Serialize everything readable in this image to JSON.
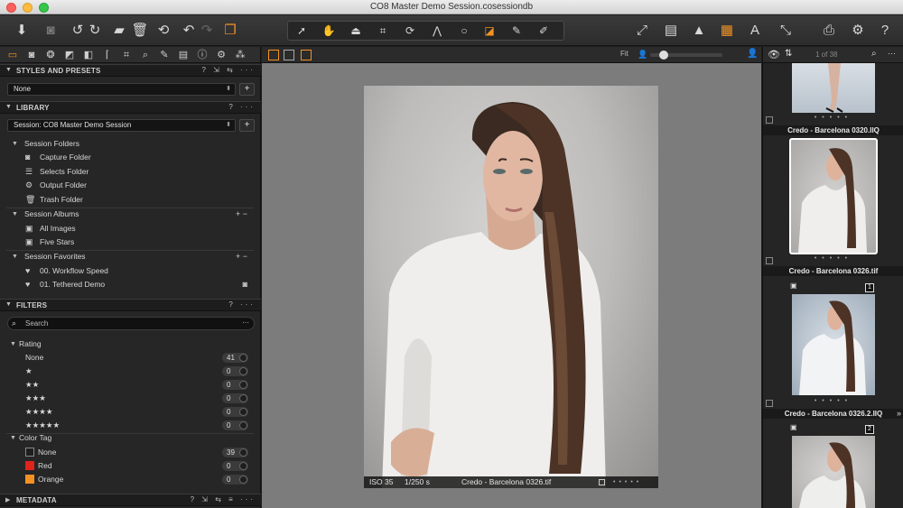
{
  "window": {
    "title": "CO8 Master Demo Session.cosessiondb"
  },
  "toolbar": {
    "left_icons": [
      "import-icon",
      "camera-icon",
      "rotate-left-icon",
      "rotate-right-icon",
      "folder-move-icon",
      "trash-icon",
      "undo-last-icon",
      "undo-icon",
      "redo-icon",
      "stack-icon"
    ],
    "cursor_tools": [
      "select-icon",
      "pan-icon",
      "loupe-icon",
      "crop-icon",
      "rotate-icon",
      "keystone-icon",
      "spot-icon",
      "mask-icon",
      "brush-icon",
      "picker-icon"
    ],
    "right_icons": [
      "expand-icon",
      "compare-icon",
      "warning-icon",
      "grid-icon",
      "text-icon",
      "fullscreen-icon",
      "print-icon",
      "settings-icon",
      "help-icon"
    ]
  },
  "sections": {
    "styles": {
      "title": "STYLES AND PRESETS",
      "dropdown_value": "None"
    },
    "library": {
      "title": "LIBRARY",
      "session_value": "Session: CO8 Master Demo Session",
      "groups": [
        {
          "label": "Session Folders",
          "items": [
            "Capture Folder",
            "Selects Folder",
            "Output Folder",
            "Trash Folder"
          ]
        },
        {
          "label": "Session Albums",
          "items": [
            "All Images",
            "Five Stars"
          ]
        },
        {
          "label": "Session Favorites",
          "items": [
            "00. Workflow Speed",
            "01. Tethered Demo"
          ]
        }
      ]
    },
    "filters": {
      "title": "FILTERS",
      "search_placeholder": "Search",
      "rating_label": "Rating",
      "ratings": [
        {
          "label": "None",
          "count": "41"
        },
        {
          "label": "★",
          "count": "0"
        },
        {
          "label": "★★",
          "count": "0"
        },
        {
          "label": "★★★",
          "count": "0"
        },
        {
          "label": "★★★★",
          "count": "0"
        },
        {
          "label": "★★★★★",
          "count": "0"
        }
      ],
      "color_tag_label": "Color Tag",
      "color_tags": [
        {
          "label": "None",
          "count": "39",
          "color": "#1e1e1e"
        },
        {
          "label": "Red",
          "count": "0",
          "color": "#e0231b"
        },
        {
          "label": "Orange",
          "count": "0",
          "color": "#f39222"
        }
      ]
    },
    "metadata": {
      "title": "METADATA"
    }
  },
  "viewer": {
    "zoom_label": "Fit",
    "iso": "ISO 35",
    "shutter": "1/250 s",
    "filename": "Credo - Barcelona 0326.tif"
  },
  "browser": {
    "count": "1 of 38",
    "thumbnails": [
      {
        "label": "Credo - Barcelona 0320.IIQ"
      },
      {
        "label": "Credo - Barcelona 0326.tif"
      },
      {
        "label": "Credo - Barcelona 0326.2.IIQ",
        "badge": "1"
      },
      {
        "badge": "2"
      }
    ]
  },
  "colors": {
    "accent": "#f39222",
    "panel": "#262626",
    "viewer_bg": "#7c7c7c"
  }
}
